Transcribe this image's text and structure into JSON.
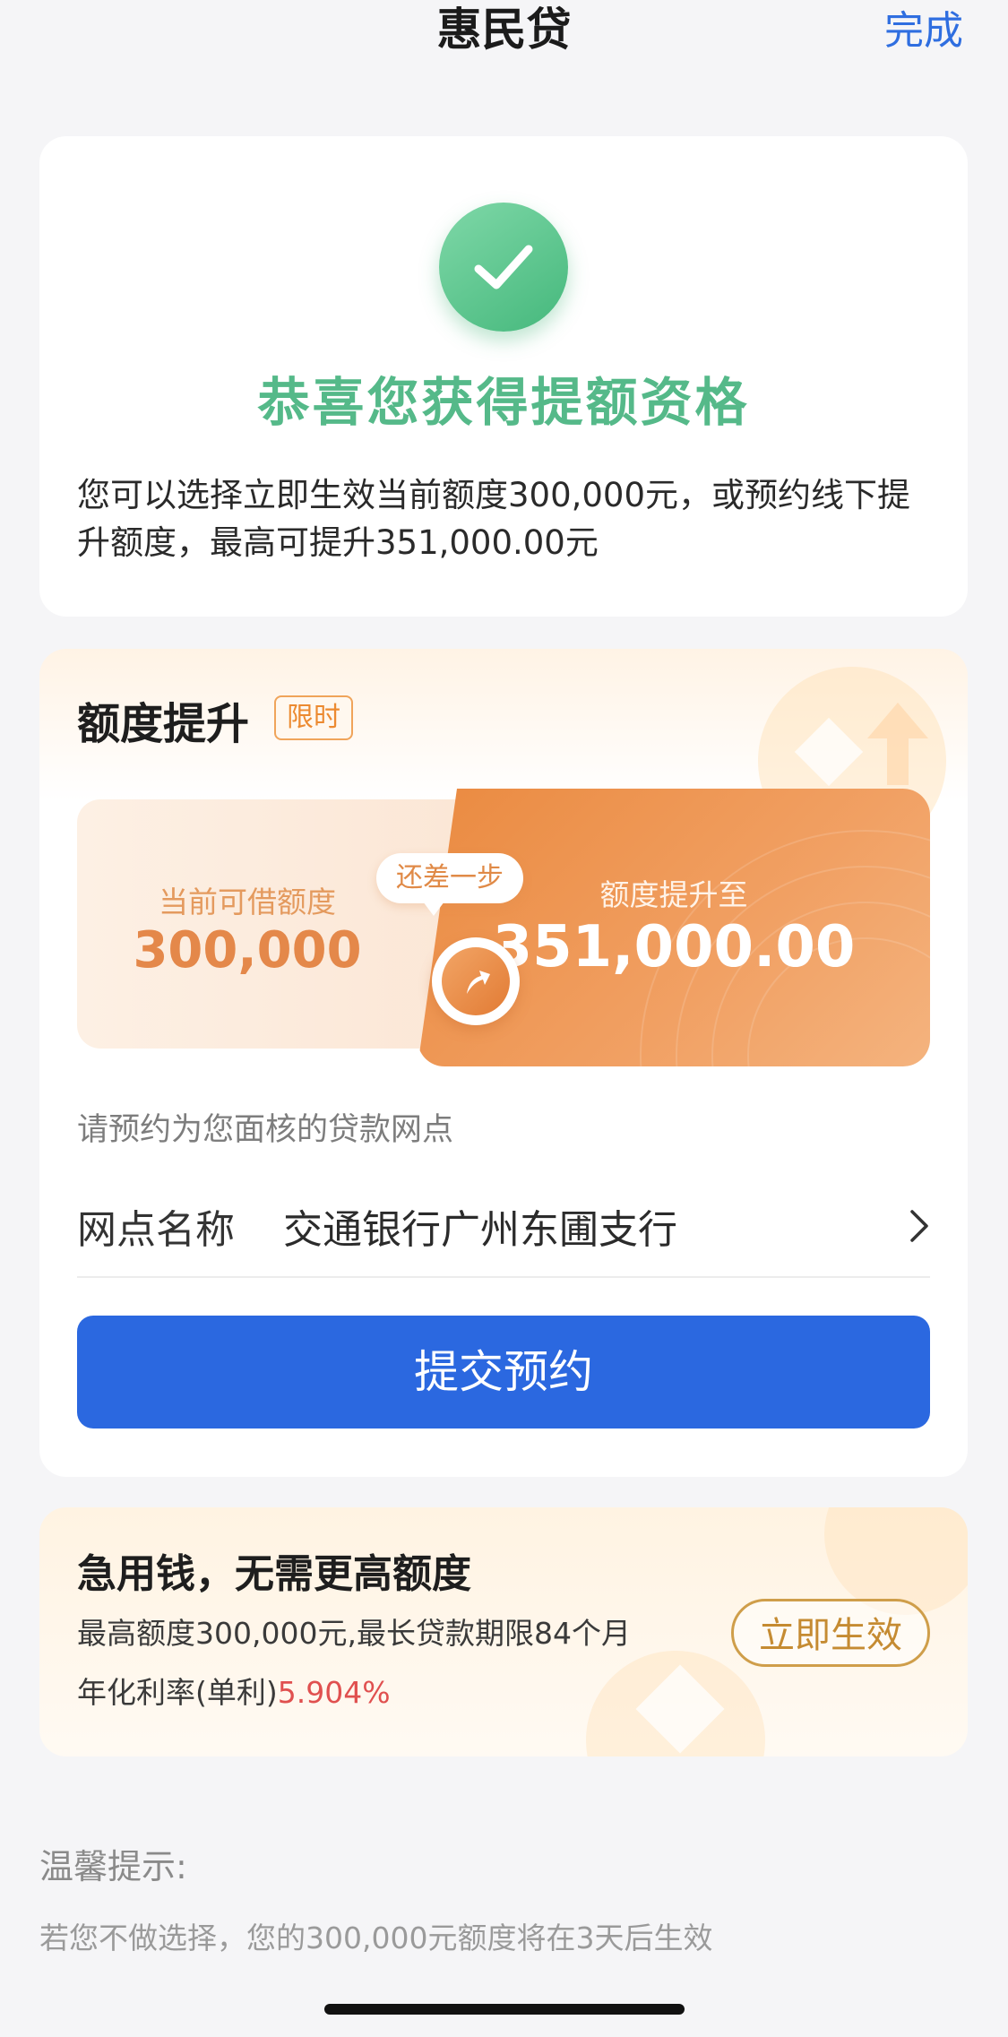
{
  "nav": {
    "title": "惠民贷",
    "done_label": "完成"
  },
  "success": {
    "icon": "check-icon",
    "title": "恭喜您获得提额资格",
    "description": "您可以选择立即生效当前额度300,000元，或预约线下提升额度，最高可提升351,000.00元"
  },
  "limit_upgrade": {
    "title": "额度提升",
    "badge": "限时",
    "current_label": "当前可借额度",
    "current_value": "300,000",
    "step_label": "还差一步",
    "upgrade_label": "额度提升至",
    "upgrade_value": "351,000.00",
    "branch_hint": "请预约为您面核的贷款网点",
    "branch_label": "网点名称",
    "branch_value": "交通银行广州东圃支行",
    "submit_label": "提交预约"
  },
  "quick": {
    "title": "急用钱，无需更高额度",
    "line1": "最高额度300,000元,最长贷款期限84个月",
    "rate_label": "年化利率(单利)",
    "rate_value": "5.904%",
    "button_label": "立即生效"
  },
  "tips": {
    "title": "温馨提示:",
    "text": "若您不做选择，您的300,000元额度将在3天后生效"
  },
  "colors": {
    "accent": "#2b68e0",
    "success": "#55b989",
    "orange": "#ea8a40",
    "rate": "#e0504f"
  }
}
